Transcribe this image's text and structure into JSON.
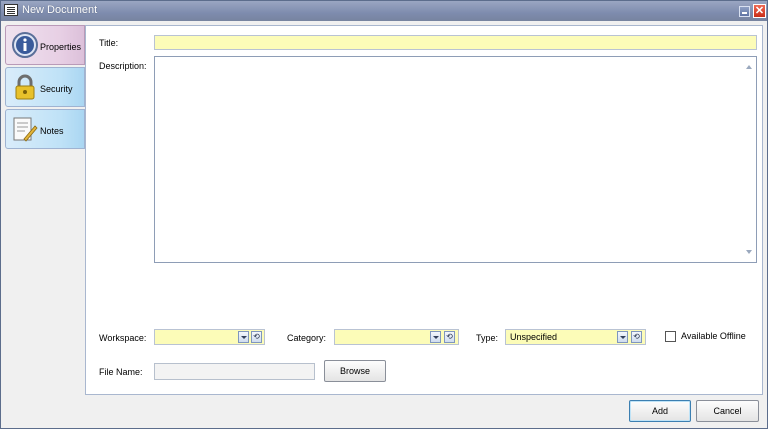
{
  "window": {
    "title": "New Document",
    "close_glyph": "✕"
  },
  "tabs": [
    {
      "label": "Properties",
      "icon": "info-icon",
      "active": true
    },
    {
      "label": "Security",
      "icon": "lock-icon",
      "active": false
    },
    {
      "label": "Notes",
      "icon": "notes-icon",
      "active": false
    }
  ],
  "form": {
    "title_label": "Title:",
    "title_value": "",
    "description_label": "Description:",
    "description_value": "",
    "workspace_label": "Workspace:",
    "workspace_value": "",
    "category_label": "Category:",
    "category_value": "",
    "type_label": "Type:",
    "type_value": "Unspecified",
    "available_offline_label": "Available Offline",
    "available_offline_checked": false,
    "file_name_label": "File Name:",
    "file_name_value": "",
    "browse_label": "Browse",
    "refresh_glyph": "⟲"
  },
  "footer": {
    "add_label": "Add",
    "cancel_label": "Cancel"
  },
  "colors": {
    "field_bg": "#fcfcb8",
    "titlebar": "#8592b2",
    "close": "#d6402a"
  }
}
